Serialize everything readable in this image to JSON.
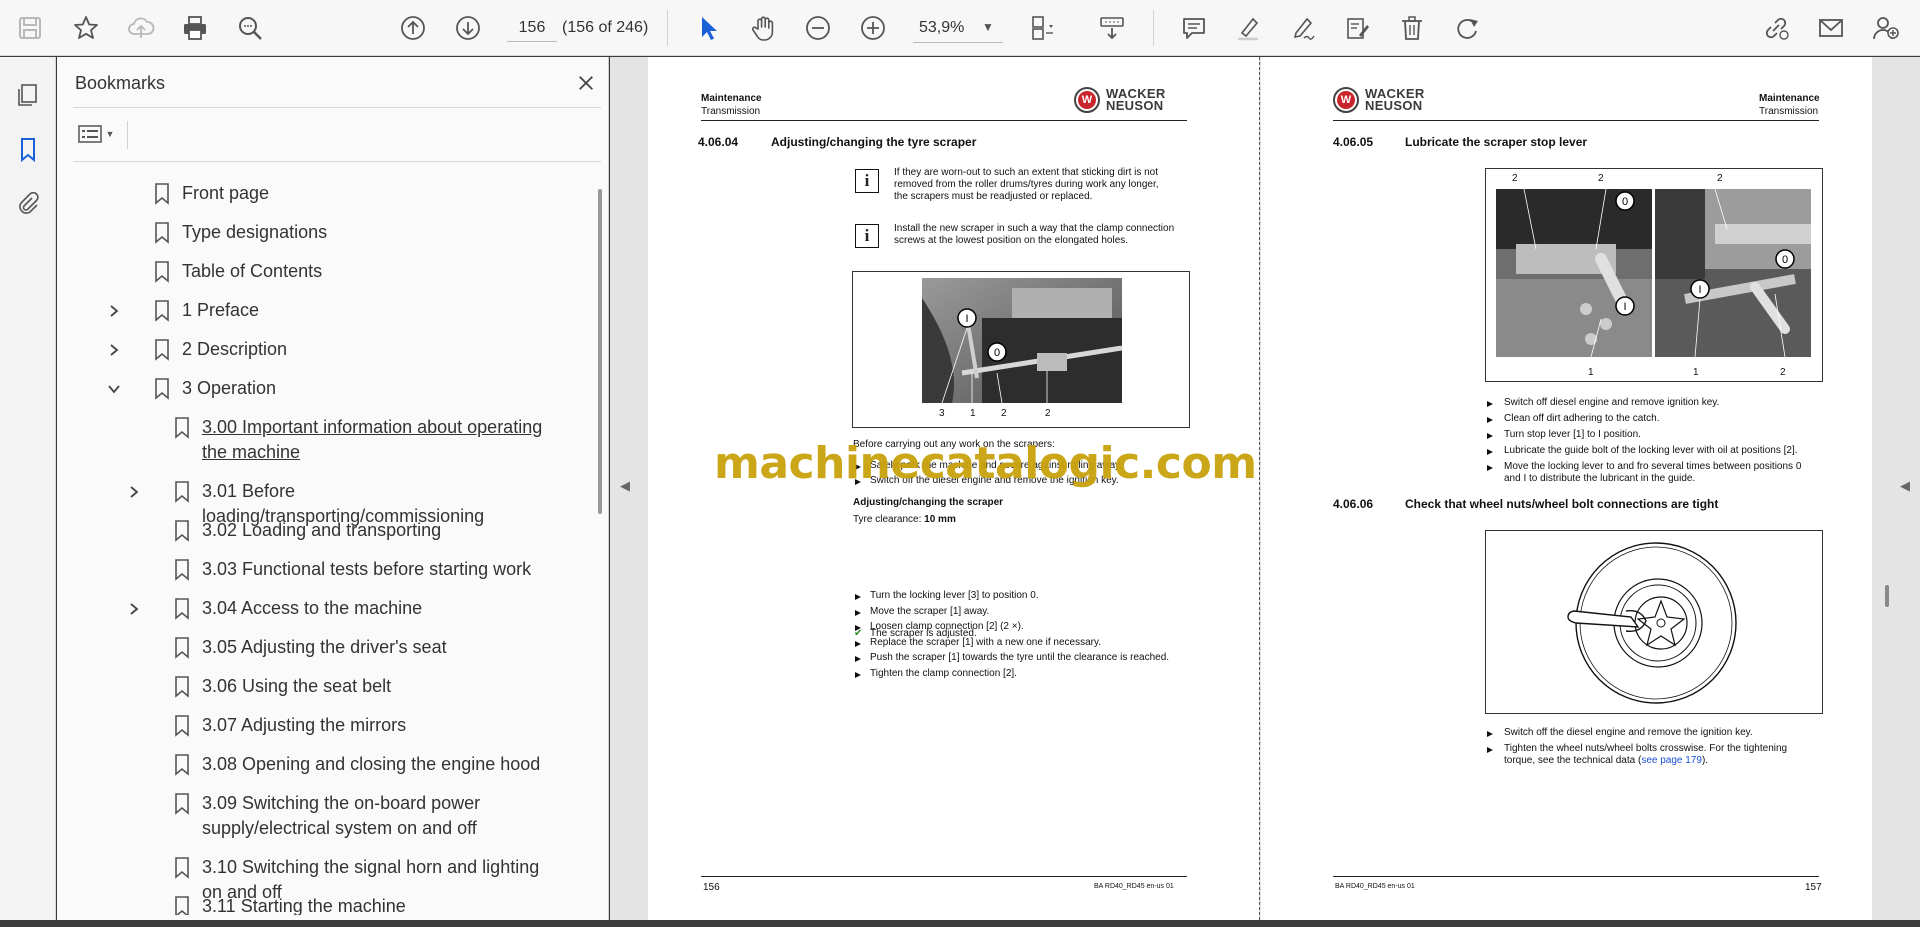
{
  "toolbar": {
    "page_current": "156",
    "page_count": "(156 of 246)",
    "zoom": "53,9%"
  },
  "icons": {
    "save": "save-icon",
    "bookmark_star": "star-icon",
    "upload": "cloud-upload-icon",
    "print": "printer-icon",
    "find": "zoom-search-icon",
    "prev": "arrow-up-circle-icon",
    "next": "arrow-down-circle-icon",
    "select": "cursor-icon",
    "hand": "hand-icon",
    "zoom_out": "zoom-out-icon",
    "zoom_in": "zoom-in-icon"
  },
  "bookmarks": {
    "title": "Bookmarks",
    "items": [
      {
        "label": "Front page",
        "level": 0,
        "expand": "none"
      },
      {
        "label": "Type designations",
        "level": 0,
        "expand": "none"
      },
      {
        "label": "Table of Contents",
        "level": 0,
        "expand": "none"
      },
      {
        "label": "1 Preface",
        "level": 0,
        "expand": "collapsed"
      },
      {
        "label": "2 Description",
        "level": 0,
        "expand": "collapsed"
      },
      {
        "label": "3 Operation",
        "level": 0,
        "expand": "expanded"
      },
      {
        "label": "3.00 Important information about operating the machine",
        "level": 1,
        "expand": "none",
        "selected": true
      },
      {
        "label": "3.01 Before loading/transporting/commissioning",
        "level": 1,
        "expand": "collapsed"
      },
      {
        "label": "3.02 Loading and transporting",
        "level": 1,
        "expand": "none"
      },
      {
        "label": "3.03 Functional tests before starting work",
        "level": 1,
        "expand": "none"
      },
      {
        "label": "3.04 Access to the machine",
        "level": 1,
        "expand": "collapsed"
      },
      {
        "label": "3.05 Adjusting the driver's seat",
        "level": 1,
        "expand": "none"
      },
      {
        "label": "3.06 Using the seat belt",
        "level": 1,
        "expand": "none"
      },
      {
        "label": "3.07 Adjusting the mirrors",
        "level": 1,
        "expand": "none"
      },
      {
        "label": "3.08 Opening and closing the engine hood",
        "level": 1,
        "expand": "none"
      },
      {
        "label": "3.09 Switching the on-board power supply/electrical system on and off",
        "level": 1,
        "expand": "none"
      },
      {
        "label": "3.10 Switching the signal horn and lighting on and off",
        "level": 1,
        "expand": "none"
      },
      {
        "label": "3.11 Starting the machine",
        "level": 1,
        "expand": "none"
      }
    ]
  },
  "page_left": {
    "header_bold": "Maintenance",
    "header_sub": "Transmission",
    "logo_line1": "WACKER",
    "logo_line2": "NEUSON",
    "section_num": "4.06.04",
    "section_title": "Adjusting/changing the tyre scraper",
    "info1": [
      "If they are worn-out to such an extent that sticking dirt is not",
      "removed from the roller drums/tyres during work any longer,",
      "the scrapers must be readjusted or replaced."
    ],
    "info2": [
      "Install the new scraper in such a way that the clamp connection",
      "screws at the lowest position on the elongated holes."
    ],
    "figure_labels": [
      "3",
      "1",
      "2",
      "2"
    ],
    "figure_markers": [
      "I",
      "0"
    ],
    "before_text": "Before carrying out any work on the scrapers:",
    "before_steps": [
      "Safely park the machine and secure against rolling away.",
      "Switch off the diesel engine and remove the ignition key."
    ],
    "sub_heading": "Adjusting/changing the scraper",
    "clearance_label": "Tyre clearance:",
    "clearance_value": "10 mm",
    "steps": [
      "Turn the locking lever [3] to position 0.",
      "Move the scraper [1] away.",
      "Loosen clamp connection [2] (2 ×).",
      "Replace the scraper [1] with a new one if necessary.",
      "Push the scraper [1] towards the tyre until the clearance is reached.",
      "Tighten the clamp connection [2]."
    ],
    "result": "The scraper is adjusted.",
    "footer_page": "156",
    "footer_doc": "BA  RD40_RD45  en-us  01"
  },
  "page_right": {
    "header_bold": "Maintenance",
    "header_sub": "Transmission",
    "logo_line1": "WACKER",
    "logo_line2": "NEUSON",
    "section1_num": "4.06.05",
    "section1_title": "Lubricate the scraper stop lever",
    "fig1_top_labels": [
      "2",
      "2",
      "2"
    ],
    "fig1_bottom_labels": [
      "1",
      "1",
      "2"
    ],
    "fig1_markers": [
      "0",
      "I",
      "0",
      "I"
    ],
    "steps1": [
      "Switch off diesel engine and remove ignition key.",
      "Clean off dirt adhering to the catch.",
      "Turn stop lever [1] to I position.",
      "Lubricate the guide bolt of the locking lever with oil at positions [2].",
      "Move the locking lever to and fro several times between positions 0",
      "and I to distribute the lubricant in the guide."
    ],
    "section2_num": "4.06.06",
    "section2_title": "Check that wheel nuts/wheel bolt connections are tight",
    "steps2_a": "Switch off the diesel engine and remove the ignition key.",
    "steps2_b1": "Tighten the wheel nuts/wheel bolts crosswise. For the tightening",
    "steps2_b2": "torque, see the technical data (",
    "steps2_link": "see page 179",
    "steps2_b3": ").",
    "footer_page": "157",
    "footer_doc": "BA  RD40_RD45  en-us  01"
  },
  "watermark": "machinecatalogic.com"
}
